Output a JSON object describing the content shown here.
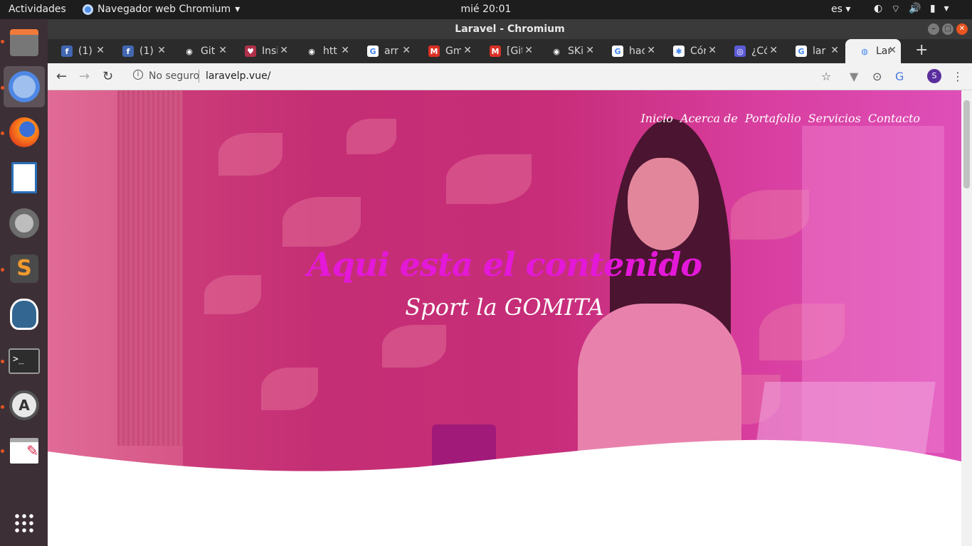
{
  "topbar": {
    "activities": "Actividades",
    "app_name": "Navegador web Chromium",
    "clock": "mié 20:01",
    "lang": "es"
  },
  "dock": {
    "items": [
      {
        "name": "files-icon",
        "glyph": "🗄"
      },
      {
        "name": "chromium-icon",
        "glyph": "◯"
      },
      {
        "name": "firefox-icon",
        "glyph": "🦊"
      },
      {
        "name": "writer-icon",
        "glyph": "📄"
      },
      {
        "name": "settings-icon",
        "glyph": "⚙"
      },
      {
        "name": "sublime-icon",
        "glyph": "S"
      },
      {
        "name": "postgres-icon",
        "glyph": "🐘"
      },
      {
        "name": "terminal-icon",
        "glyph": ">_"
      },
      {
        "name": "software-updater-icon",
        "glyph": "A"
      },
      {
        "name": "text-editor-icon",
        "glyph": "✎"
      },
      {
        "name": "apps-grid-icon",
        "glyph": "⋮⋮⋮"
      }
    ]
  },
  "window": {
    "title": "Laravel - Chromium"
  },
  "tabs": [
    {
      "title": "(1)",
      "icon": "f",
      "color": "#4267b2"
    },
    {
      "title": "(1)",
      "icon": "f",
      "color": "#4267b2"
    },
    {
      "title": "Git",
      "icon": "◉",
      "color": "#2b2b2b"
    },
    {
      "title": "Insi",
      "icon": "♥",
      "color": "#b0304a"
    },
    {
      "title": "htt",
      "icon": "◉",
      "color": "#2b2b2b"
    },
    {
      "title": "arr",
      "icon": "G",
      "color": "#ffffff"
    },
    {
      "title": "Gm",
      "icon": "M",
      "color": "#d93025"
    },
    {
      "title": "[Git",
      "icon": "M",
      "color": "#d93025"
    },
    {
      "title": "SKi",
      "icon": "◉",
      "color": "#2b2b2b"
    },
    {
      "title": "hac",
      "icon": "G",
      "color": "#ffffff"
    },
    {
      "title": "Cór",
      "icon": "✱",
      "color": "#ffffff"
    },
    {
      "title": "¿Có",
      "icon": "◎",
      "color": "#5b5bd6"
    },
    {
      "title": "lar",
      "icon": "G",
      "color": "#ffffff"
    },
    {
      "title": "Lar",
      "icon": "◍",
      "color": "#f2f2f2"
    }
  ],
  "toolbar": {
    "security": "No seguro",
    "url": "laravelp.vue/",
    "avatar_letter": "S"
  },
  "site": {
    "nav": [
      "Inicio",
      "Acerca de",
      "Portafolio",
      "Servicios",
      "Contacto"
    ],
    "headline": "Aqui esta el contenido",
    "subheadline": "Sport la GOMITA",
    "accent": "#e418d8"
  }
}
